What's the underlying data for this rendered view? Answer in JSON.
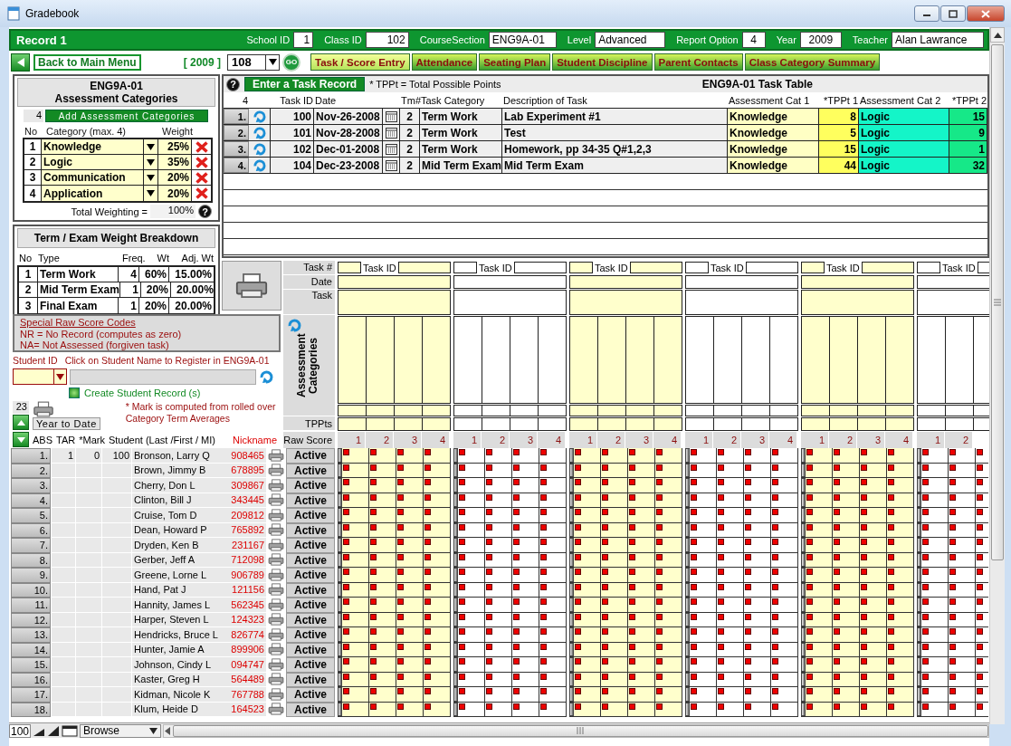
{
  "window": {
    "title": "Gradebook"
  },
  "record": {
    "title": "Record 1",
    "fields": [
      {
        "label": "School ID",
        "value": "1"
      },
      {
        "label": "Class ID",
        "value": "102"
      },
      {
        "label": "CourseSection",
        "value": "ENG9A-01"
      },
      {
        "label": "Level",
        "value": "Advanced"
      },
      {
        "label": "Report Option",
        "value": "4"
      },
      {
        "label": "Year",
        "value": "2009"
      },
      {
        "label": "Teacher",
        "value": "Alan Lawrance"
      }
    ]
  },
  "nav": {
    "back": "Back  to Main Menu",
    "year": "[ 2009 ]",
    "class_select": "108",
    "go": "GO",
    "tabs": [
      {
        "label": "Task / Score Entry",
        "selected": true
      },
      {
        "label": "Attendance",
        "selected": false
      },
      {
        "label": "Seating Plan",
        "selected": false
      },
      {
        "label": "Student Discipline",
        "selected": false
      },
      {
        "label": "Parent Contacts",
        "selected": false
      },
      {
        "label": "Class Category Summary",
        "selected": false
      }
    ]
  },
  "categories": {
    "title_line_1": "ENG9A-01",
    "title_line_2": "Assessment Categories",
    "count": "4",
    "add_button": "Add Assessment Categories",
    "columns": [
      "No",
      "Category (max. 4)",
      "Weight"
    ],
    "rows": [
      {
        "no": "1",
        "name": "Knowledge",
        "weight": "25%"
      },
      {
        "no": "2",
        "name": "Logic",
        "weight": "35%"
      },
      {
        "no": "3",
        "name": "Communication",
        "weight": "20%"
      },
      {
        "no": "4",
        "name": "Application",
        "weight": "20%"
      }
    ],
    "total_label": "Total Weighting =",
    "total": "100%",
    "help": "?"
  },
  "term_breakdown": {
    "title": "Term / Exam Weight Breakdown",
    "columns": [
      "No",
      "Type",
      "Freq.",
      "Wt",
      "Adj. Wt"
    ],
    "rows": [
      {
        "no": "1",
        "type": "Term Work",
        "freq": "4",
        "wt": "60%",
        "adj_wt": "15.00%"
      },
      {
        "no": "2",
        "type": "Mid Term Exam",
        "freq": "1",
        "wt": "20%",
        "adj_wt": "20.00%"
      },
      {
        "no": "3",
        "type": "Final Exam",
        "freq": "1",
        "wt": "20%",
        "adj_wt": "20.00%"
      }
    ]
  },
  "task_table": {
    "help": "?",
    "enter_button": "Enter a Task Record",
    "note": "* TPPt = Total Possible Points",
    "title": "ENG9A-01 Task Table",
    "columns": [
      "4",
      "Task ID",
      "Date",
      "Tm#",
      "Task Category",
      "Description of Task",
      "Assessment Cat 1",
      "*TPPt 1",
      "Assessment Cat 2",
      "*TPPt 2"
    ],
    "rows": [
      {
        "no": "1.",
        "task_id": "100",
        "date": "Nov-26-2008",
        "term": "2",
        "category": "Term Work",
        "description": "Lab Experiment #1",
        "cat_1": "Knowledge",
        "tppt_1": "8",
        "cat_2": "Logic",
        "tppt_2": "15"
      },
      {
        "no": "2.",
        "task_id": "101",
        "date": "Nov-28-2008",
        "term": "2",
        "category": "Term Work",
        "description": "Test",
        "cat_1": "Knowledge",
        "tppt_1": "5",
        "cat_2": "Logic",
        "tppt_2": "9"
      },
      {
        "no": "3.",
        "task_id": "102",
        "date": "Dec-01-2008",
        "term": "2",
        "category": "Term Work",
        "description": "Homework, pp 34-35 Q#1,2,3",
        "cat_1": "Knowledge",
        "tppt_1": "15",
        "cat_2": "Logic",
        "tppt_2": "1"
      },
      {
        "no": "4.",
        "task_id": "104",
        "date": "Dec-23-2008",
        "term": "2",
        "category": "Mid Term Exam",
        "description": "Mid Term Exam",
        "cat_1": "Knowledge",
        "tppt_1": "44",
        "cat_2": "Logic",
        "tppt_2": "32"
      }
    ]
  },
  "score_codes": {
    "title": "Special Raw Score Codes",
    "lines": [
      "NR = No Record (computes as zero)",
      "NA= Not Assessed (forgiven task)"
    ]
  },
  "register": {
    "student_id_label": "Student ID",
    "hint": "Click on Student Name to Register in ENG9A-01",
    "create_button": "Create Student Record (s)"
  },
  "score_grid": {
    "row_labels": [
      "Task #",
      "Date",
      "Task",
      "Assessment Categories",
      "TPPts",
      "Raw Score"
    ],
    "tasks": [
      {
        "id_label": "Task ID",
        "highlighted": true,
        "raw_scores": [
          "1",
          "2",
          "3",
          "4"
        ]
      },
      {
        "id_label": "Task ID",
        "highlighted": false,
        "raw_scores": [
          "1",
          "2",
          "3",
          "4"
        ]
      },
      {
        "id_label": "Task ID",
        "highlighted": true,
        "raw_scores": [
          "1",
          "2",
          "3",
          "4"
        ]
      },
      {
        "id_label": "Task ID",
        "highlighted": false,
        "raw_scores": [
          "1",
          "2",
          "3",
          "4"
        ]
      },
      {
        "id_label": "Task ID",
        "highlighted": true,
        "raw_scores": [
          "1",
          "2",
          "3",
          "4"
        ]
      },
      {
        "id_label": "Task ID",
        "highlighted": false,
        "raw_scores": [
          "1",
          "2"
        ]
      }
    ]
  },
  "roster": {
    "count": "23",
    "year_to_date": "Year to Date",
    "note_lines": [
      "*  Mark is computed from rolled over",
      "Category Term Averages"
    ],
    "columns": [
      "ABS",
      "TAR",
      "*Mark",
      "Student (Last /First / MI)",
      "Nickname"
    ],
    "students": [
      {
        "no": "1.",
        "abs": "1",
        "tar": "0",
        "mark": "100",
        "name": "Bronson, Larry Q",
        "nickname": "908465",
        "status": "Active"
      },
      {
        "no": "2.",
        "name": "Brown, Jimmy B",
        "nickname": "678895",
        "status": "Active"
      },
      {
        "no": "3.",
        "name": "Cherry, Don L",
        "nickname": "309867",
        "status": "Active"
      },
      {
        "no": "4.",
        "name": "Clinton, Bill J",
        "nickname": "343445",
        "status": "Active"
      },
      {
        "no": "5.",
        "name": "Cruise, Tom D",
        "nickname": "209812",
        "status": "Active"
      },
      {
        "no": "6.",
        "name": "Dean, Howard P",
        "nickname": "765892",
        "status": "Active"
      },
      {
        "no": "7.",
        "name": "Dryden, Ken B",
        "nickname": "231167",
        "status": "Active"
      },
      {
        "no": "8.",
        "name": "Gerber, Jeff A",
        "nickname": "712098",
        "status": "Active"
      },
      {
        "no": "9.",
        "name": "Greene, Lorne L",
        "nickname": "906789",
        "status": "Active"
      },
      {
        "no": "10.",
        "name": "Hand, Pat J",
        "nickname": "121156",
        "status": "Active"
      },
      {
        "no": "11.",
        "name": "Hannity, James L",
        "nickname": "562345",
        "status": "Active"
      },
      {
        "no": "12.",
        "name": "Harper, Steven L",
        "nickname": "124323",
        "status": "Active"
      },
      {
        "no": "13.",
        "name": "Hendricks, Bruce L",
        "nickname": "826774",
        "status": "Active"
      },
      {
        "no": "14.",
        "name": "Hunter, Jamie A",
        "nickname": "899906",
        "status": "Active"
      },
      {
        "no": "15.",
        "name": "Johnson, Cindy L",
        "nickname": "094747",
        "status": "Active"
      },
      {
        "no": "16.",
        "name": "Kaster, Greg H",
        "nickname": "564489",
        "status": "Active"
      },
      {
        "no": "17.",
        "name": "Kidman, Nicole K",
        "nickname": "767788",
        "status": "Active"
      },
      {
        "no": "18.",
        "name": "Klum, Heide D",
        "nickname": "164523",
        "status": "Active"
      }
    ]
  },
  "status_bar": {
    "zoom": "100",
    "mode": "Browse"
  }
}
